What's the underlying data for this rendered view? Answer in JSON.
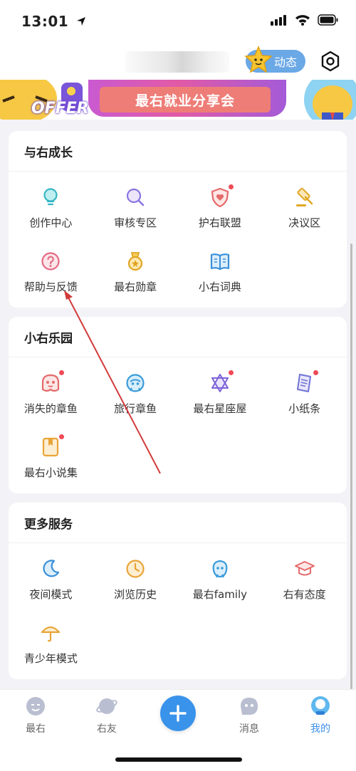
{
  "status_bar": {
    "time": "13:01"
  },
  "header": {
    "dongtai_label": "动态"
  },
  "banner": {
    "offer_text": "OFFER",
    "title": "最右就业分享会"
  },
  "sections": [
    {
      "title": "与右成长",
      "items": [
        {
          "label": "创作中心",
          "icon": "lightbulb-icon",
          "dot": false
        },
        {
          "label": "审核专区",
          "icon": "magnifier-icon",
          "dot": false
        },
        {
          "label": "护右联盟",
          "icon": "shield-heart-icon",
          "dot": true
        },
        {
          "label": "决议区",
          "icon": "gavel-icon",
          "dot": false
        },
        {
          "label": "帮助与反馈",
          "icon": "help-icon",
          "dot": false
        },
        {
          "label": "最右勋章",
          "icon": "medal-icon",
          "dot": false
        },
        {
          "label": "小右词典",
          "icon": "book-icon",
          "dot": false
        }
      ]
    },
    {
      "title": "小右乐园",
      "items": [
        {
          "label": "消失的章鱼",
          "icon": "octopus-icon",
          "dot": true
        },
        {
          "label": "旅行章鱼",
          "icon": "travel-octopus-icon",
          "dot": false
        },
        {
          "label": "最右星座屋",
          "icon": "star-of-david-icon",
          "dot": true
        },
        {
          "label": "小纸条",
          "icon": "paper-note-icon",
          "dot": true
        },
        {
          "label": "最右小说集",
          "icon": "novel-book-icon",
          "dot": true
        }
      ]
    },
    {
      "title": "更多服务",
      "items": [
        {
          "label": "夜间模式",
          "icon": "moon-icon",
          "dot": false
        },
        {
          "label": "浏览历史",
          "icon": "clock-icon",
          "dot": false
        },
        {
          "label": "最右family",
          "icon": "family-icon",
          "dot": false
        },
        {
          "label": "右有态度",
          "icon": "graduation-cap-icon",
          "dot": false
        },
        {
          "label": "青少年模式",
          "icon": "umbrella-icon",
          "dot": false
        }
      ]
    }
  ],
  "tabbar": {
    "tabs": [
      {
        "label": "最右",
        "icon": "home-face-icon"
      },
      {
        "label": "右友",
        "icon": "planet-icon"
      },
      {
        "label": "消息",
        "icon": "message-ghost-icon"
      },
      {
        "label": "我的",
        "icon": "profile-icon"
      }
    ],
    "active_index": 3
  },
  "colors": {
    "accent": "#3a93ea",
    "notify_dot": "#ef4a57",
    "annotation_arrow": "#d23b3b"
  }
}
